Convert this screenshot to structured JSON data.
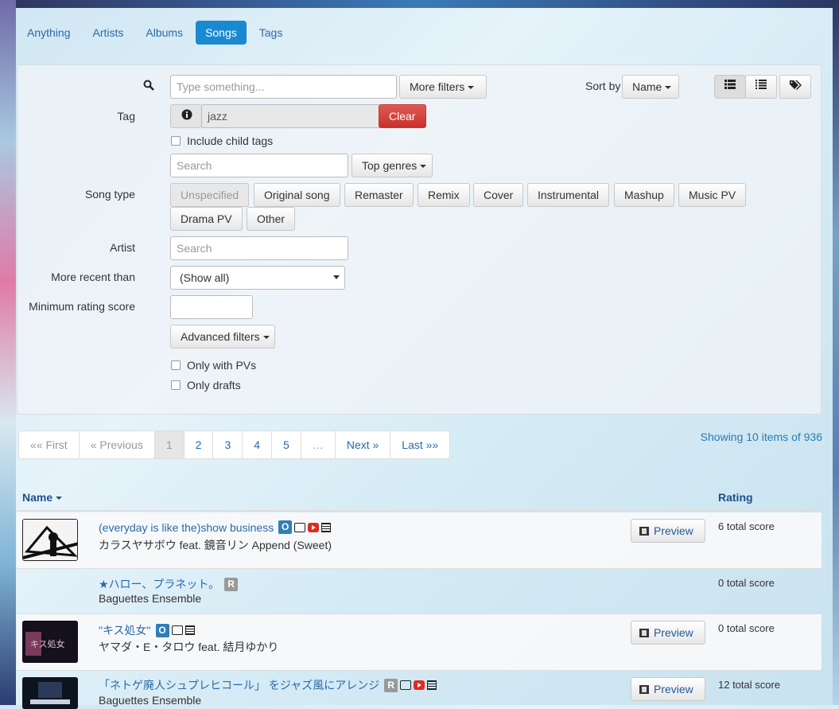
{
  "nav": {
    "tabs": [
      "Anything",
      "Artists",
      "Albums",
      "Songs",
      "Tags"
    ],
    "active": "Songs"
  },
  "search": {
    "placeholder": "Type something...",
    "more_filters": "More filters"
  },
  "sort": {
    "label": "Sort by",
    "value": "Name"
  },
  "tag": {
    "label": "Tag",
    "value": "jazz",
    "clear": "Clear",
    "include_child": "Include child tags"
  },
  "genre": {
    "placeholder": "Search",
    "top_genres": "Top genres"
  },
  "song_type": {
    "label": "Song type",
    "options": [
      "Unspecified",
      "Original song",
      "Remaster",
      "Remix",
      "Cover",
      "Instrumental",
      "Mashup",
      "Music PV",
      "Drama PV",
      "Other"
    ]
  },
  "artist": {
    "label": "Artist",
    "placeholder": "Search"
  },
  "recent": {
    "label": "More recent than",
    "value": "(Show all)"
  },
  "rating_filter": {
    "label": "Minimum rating score",
    "value": ""
  },
  "advanced": {
    "label": "Advanced filters"
  },
  "checks": {
    "only_pvs": "Only with PVs",
    "only_drafts": "Only drafts"
  },
  "pager": {
    "first": "«« First",
    "prev": "« Previous",
    "pages": [
      "1",
      "2",
      "3",
      "4",
      "5"
    ],
    "ellipsis": "…",
    "next": "Next »",
    "last": "Last »»",
    "current": "1"
  },
  "showing": "Showing 10 items of 936",
  "table": {
    "col_name": "Name",
    "col_rating": "Rating",
    "preview_label": "Preview"
  },
  "songs": [
    {
      "title": "(everyday is like the)show business",
      "artist": "カラスヤサボウ feat. 鏡音リン Append (Sweet)",
      "badge": "O",
      "rating": "6 total score",
      "icons": [
        "nico-icon",
        "youtube-icon",
        "calendar-icon"
      ]
    },
    {
      "title": "★ハロー、プラネット。",
      "artist": "Baguettes Ensemble",
      "badge": "R",
      "rating": "0 total score",
      "icons": []
    },
    {
      "title": "\"キス処女\"",
      "artist": "ヤマダ・E・タロウ feat. 結月ゆかり",
      "badge": "O",
      "rating": "0 total score",
      "icons": [
        "nico-icon",
        "calendar-icon"
      ]
    },
    {
      "title": "「ネトゲ廃人シュプレヒコール」 をジャズ風にアレンジ",
      "artist": "Baguettes Ensemble",
      "badge": "R",
      "rating": "12 total score",
      "icons": [
        "nico-icon",
        "youtube-icon",
        "calendar-icon"
      ]
    }
  ],
  "colors": {
    "accent": "#1a8ad0",
    "link": "#2a6aa8",
    "clear": "#d9534f",
    "badge_original": "#2e7fb8",
    "badge_remaster": "#999999"
  }
}
